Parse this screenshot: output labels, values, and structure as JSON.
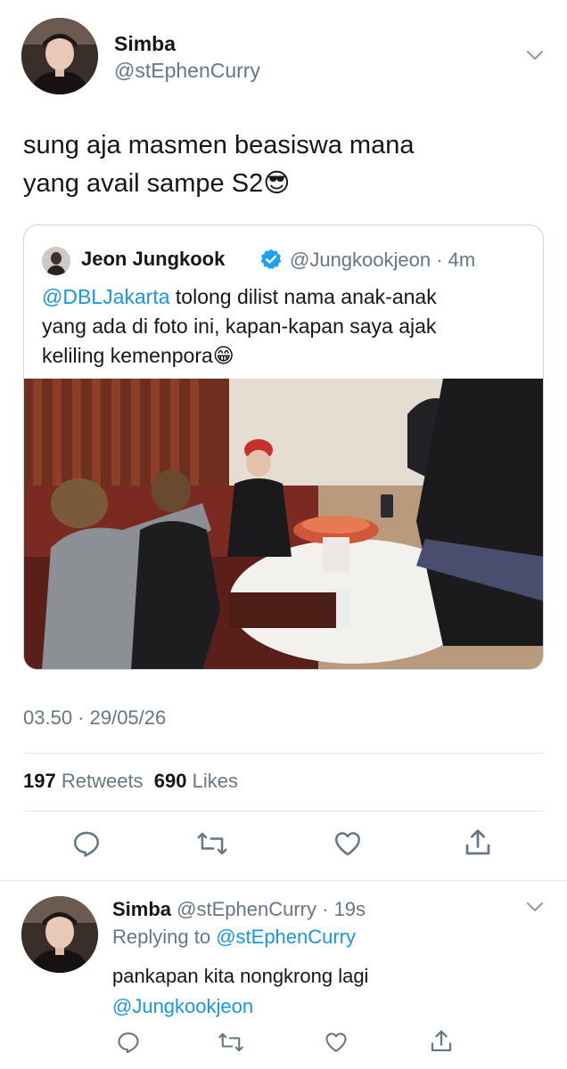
{
  "main_tweet": {
    "display_name": "Simba",
    "handle": "@stEphenCurry",
    "text_line1": "sung aja masmen beasiswa mana",
    "text_line2": "yang avail sampe S2",
    "emoji": "😎"
  },
  "quoted_tweet": {
    "display_name": "Jeon Jungkook",
    "handle": "@Jungkookjeon",
    "time": "4m",
    "mention": "@DBLJakarta",
    "text_line1_rest": " tolong dilist nama anak-anak",
    "text_line2": "yang ada di foto ini, kapan-kapan saya ajak",
    "text_line3": "keliling kemenpora",
    "emoji": "😁"
  },
  "timestamp": "03.50 · 29/05/26",
  "stats": {
    "retweets_count": "197",
    "retweets_label": "Retweets",
    "likes_count": "690",
    "likes_label": "Likes"
  },
  "reply": {
    "display_name": "Simba",
    "handle": "@stEphenCurry",
    "time": "19s",
    "replying_prefix": "Replying to",
    "replying_handle": "@stEphenCurry",
    "text_line1": "pankapan kita nongkrong lagi",
    "text_line2": "@Jungkookjeon"
  },
  "colors": {
    "link": "#1b95e0",
    "muted": "#657786",
    "verified": "#1da1f2",
    "border": "#ccd6dd"
  },
  "icons": [
    "reply-icon",
    "retweet-icon",
    "like-icon",
    "share-icon",
    "chevron-down-icon",
    "verified-icon"
  ]
}
